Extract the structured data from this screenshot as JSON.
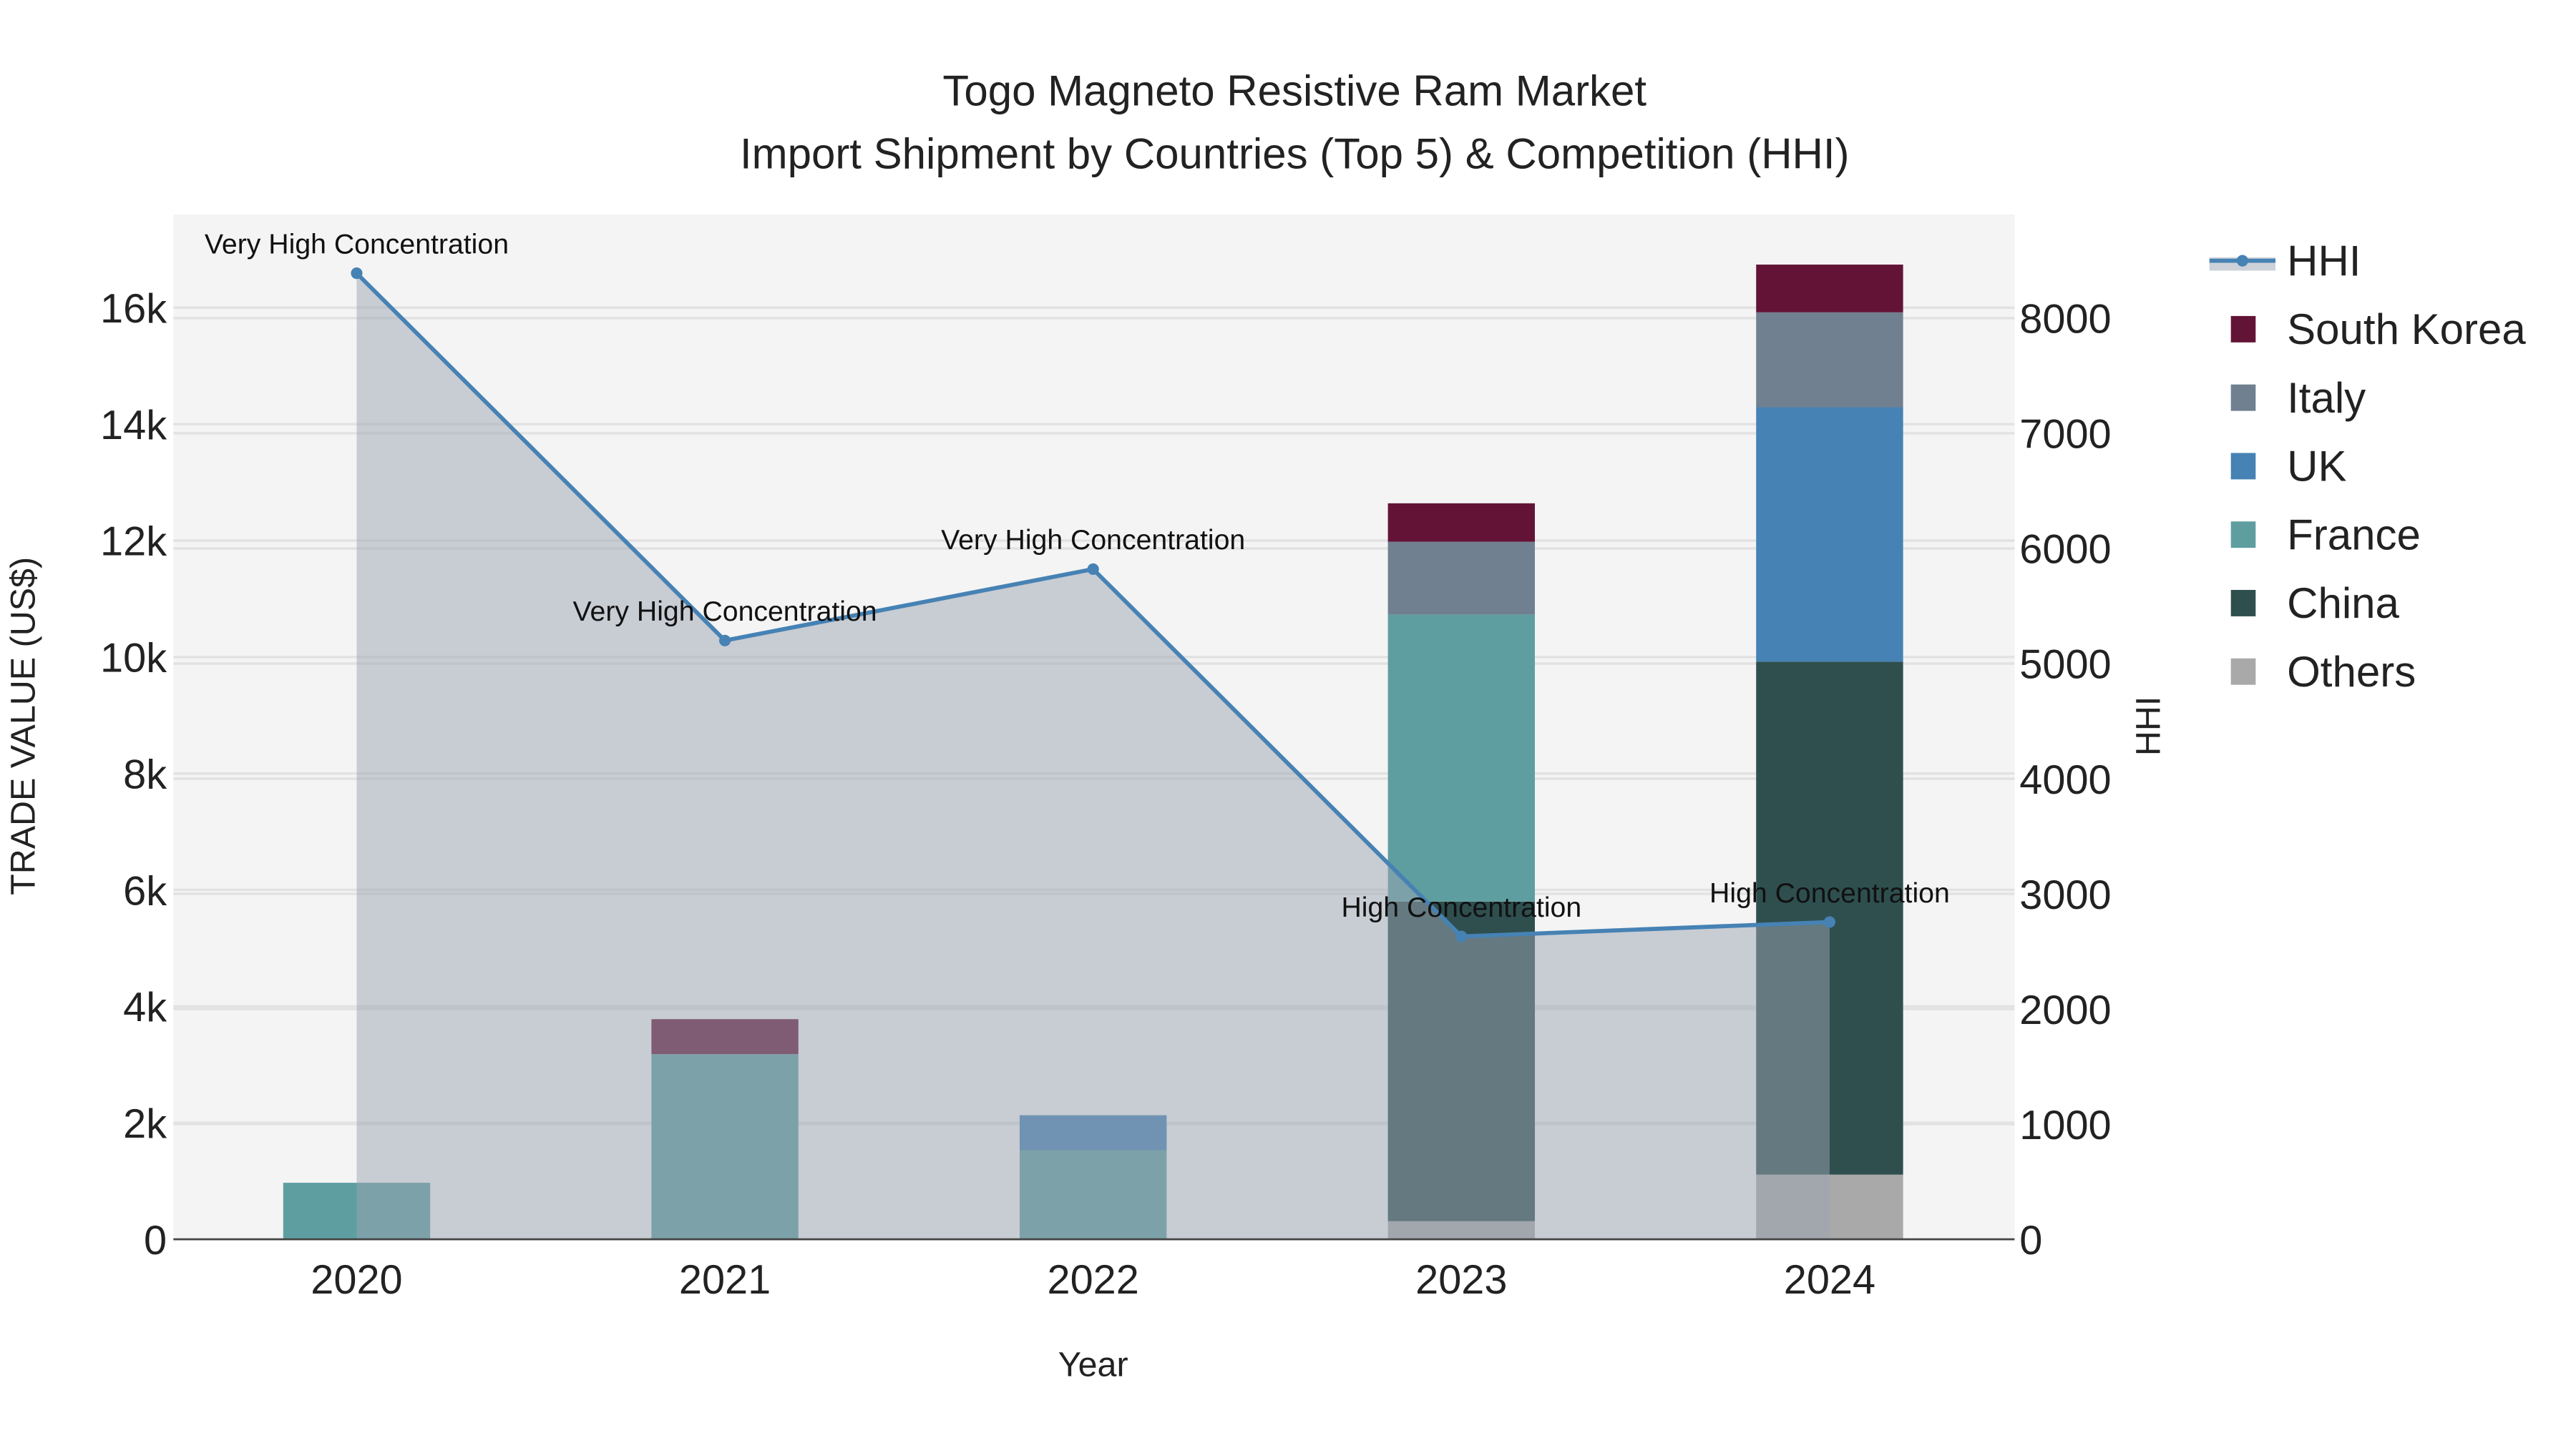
{
  "chart_data": {
    "type": "bar",
    "title": "Togo Magneto Resistive Ram Market",
    "subtitle": "Import Shipment by Countries (Top 5) & Competition (HHI)",
    "xlabel": "Year",
    "ylabel": "TRADE VALUE (US$)",
    "y2label": "HHI",
    "categories": [
      "2020",
      "2021",
      "2022",
      "2023",
      "2024"
    ],
    "ylim": [
      0,
      17600
    ],
    "y2lim": [
      0,
      8900
    ],
    "yticks": [
      0,
      2000,
      4000,
      6000,
      8000,
      10000,
      12000,
      14000,
      16000
    ],
    "ytick_labels": [
      "0",
      "2k",
      "4k",
      "6k",
      "8k",
      "10k",
      "12k",
      "14k",
      "16k"
    ],
    "y2ticks": [
      0,
      1000,
      2000,
      3000,
      4000,
      5000,
      6000,
      7000,
      8000
    ],
    "y2tick_labels": [
      "0",
      "1000",
      "2000",
      "3000",
      "4000",
      "5000",
      "6000",
      "7000",
      "8000"
    ],
    "grid": true,
    "legend_position": "right",
    "series": [
      {
        "name": "Others",
        "color": "#a9a9a9",
        "values": [
          0,
          0,
          0,
          310,
          1110
        ]
      },
      {
        "name": "China",
        "color": "#2f4f4f",
        "values": [
          0,
          0,
          0,
          5490,
          8810
        ]
      },
      {
        "name": "France",
        "color": "#5f9ea0",
        "values": [
          970,
          3180,
          1530,
          4930,
          0
        ]
      },
      {
        "name": "UK",
        "color": "#4682b4",
        "values": [
          0,
          0,
          600,
          0,
          4370
        ]
      },
      {
        "name": "Italy",
        "color": "#708090",
        "values": [
          0,
          0,
          0,
          1250,
          1630
        ]
      },
      {
        "name": "South Korea",
        "color": "#631436",
        "values": [
          0,
          600,
          0,
          660,
          820
        ]
      }
    ],
    "hhi": {
      "name": "HHI",
      "color": "#4682b4",
      "values": [
        8390,
        5200,
        5820,
        2630,
        2755
      ],
      "labels": [
        "Very High Concentration",
        "Very High Concentration",
        "Very High Concentration",
        "High Concentration",
        "High Concentration"
      ]
    },
    "legend_order": [
      "HHI",
      "South Korea",
      "Italy",
      "UK",
      "France",
      "China",
      "Others"
    ]
  }
}
